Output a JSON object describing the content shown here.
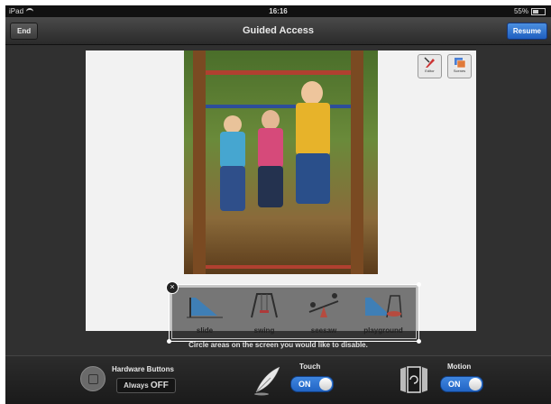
{
  "status_bar": {
    "carrier": "iPad",
    "time": "16:16",
    "battery": "55%"
  },
  "nav": {
    "title": "Guided Access",
    "end_label": "End",
    "resume_label": "Resume"
  },
  "app": {
    "editor_label": "Editor",
    "scenes_label": "Scenes",
    "symbols": [
      {
        "label": "slide",
        "icon": "slide-icon"
      },
      {
        "label": "swing",
        "icon": "swing-icon"
      },
      {
        "label": "seesaw",
        "icon": "seesaw-icon"
      },
      {
        "label": "playground",
        "icon": "playground-icon"
      }
    ]
  },
  "instruction": "Circle areas on the screen you would like to disable.",
  "options": {
    "hardware_buttons": {
      "label": "Hardware Buttons",
      "value_prefix": "Always",
      "value_state": "OFF",
      "icon": "home-button-icon"
    },
    "touch": {
      "label": "Touch",
      "state": "ON",
      "icon": "feather-icon"
    },
    "motion": {
      "label": "Motion",
      "state": "ON",
      "icon": "rotate-device-icon"
    }
  },
  "colors": {
    "accent_blue": "#2a6fd0",
    "toolbar_dark": "#262626"
  }
}
